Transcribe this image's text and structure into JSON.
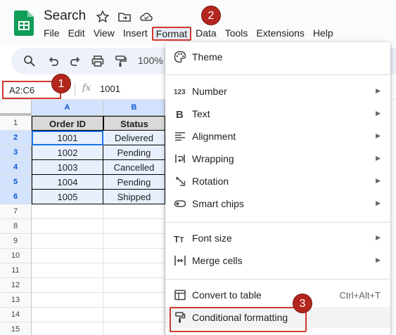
{
  "app": {
    "doc_title": "Search"
  },
  "menu": [
    {
      "label": "File",
      "active": false
    },
    {
      "label": "Edit",
      "active": false
    },
    {
      "label": "View",
      "active": false
    },
    {
      "label": "Insert",
      "active": false
    },
    {
      "label": "Format",
      "active": true
    },
    {
      "label": "Data",
      "active": false
    },
    {
      "label": "Tools",
      "active": false
    },
    {
      "label": "Extensions",
      "active": false
    },
    {
      "label": "Help",
      "active": false
    }
  ],
  "toolbar": {
    "zoom": "100%"
  },
  "formula_bar": {
    "name_box": "A2:C6",
    "fx_label": "fx",
    "value": "1001"
  },
  "grid": {
    "columns": [
      "A",
      "B"
    ],
    "rows": [
      "1",
      "2",
      "3",
      "4",
      "5",
      "6",
      "7",
      "8",
      "9",
      "10",
      "11",
      "12",
      "13",
      "14",
      "15"
    ],
    "selected_rows": [
      2,
      3,
      4,
      5,
      6
    ],
    "header_row": [
      "Order ID",
      "Status"
    ],
    "data": [
      [
        "1001",
        "Delivered"
      ],
      [
        "1002",
        "Pending"
      ],
      [
        "1003",
        "Cancelled"
      ],
      [
        "1004",
        "Pending"
      ],
      [
        "1005",
        "Shipped"
      ]
    ]
  },
  "format_menu": {
    "items": [
      {
        "label": "Theme",
        "icon": "palette-icon",
        "submenu": false
      },
      {
        "label": "Number",
        "icon": "number-123-icon",
        "submenu": true
      },
      {
        "label": "Text",
        "icon": "bold-b-icon",
        "submenu": true
      },
      {
        "label": "Alignment",
        "icon": "align-left-icon",
        "submenu": true
      },
      {
        "label": "Wrapping",
        "icon": "wrap-icon",
        "submenu": true
      },
      {
        "label": "Rotation",
        "icon": "rotation-icon",
        "submenu": true
      },
      {
        "label": "Smart chips",
        "icon": "chip-icon",
        "submenu": true
      },
      {
        "label": "Font size",
        "icon": "font-size-icon",
        "submenu": true
      },
      {
        "label": "Merge cells",
        "icon": "merge-cells-icon",
        "submenu": true
      },
      {
        "label": "Convert to table",
        "icon": "table-icon",
        "shortcut": "Ctrl+Alt+T"
      },
      {
        "label": "Conditional formatting",
        "icon": "paint-roller-icon",
        "highlighted": true
      }
    ]
  },
  "badges": [
    "1",
    "2",
    "3"
  ],
  "colors": {
    "badge": "#b3261e",
    "highlight_border": "#d0382d",
    "selection_fill": "#e8f0fe",
    "header_fill": "#d9d9d9",
    "logo_green": "#0f9d58"
  }
}
